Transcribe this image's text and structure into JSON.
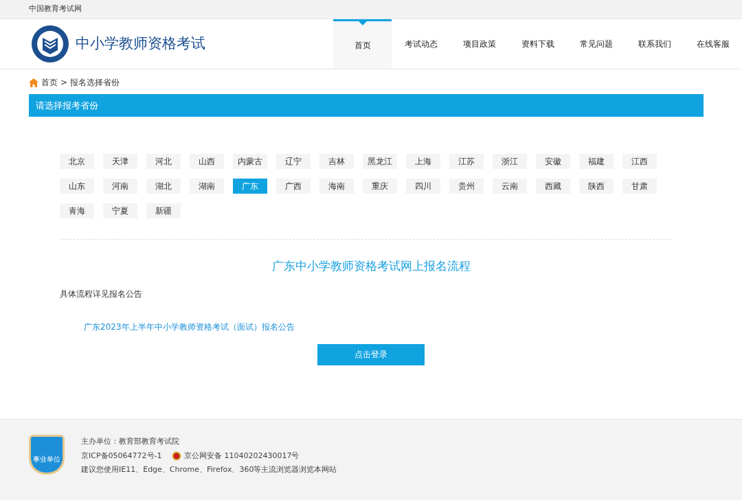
{
  "top_bar": {
    "site_name": "中国教育考试网"
  },
  "header": {
    "title": "中小学教师资格考试"
  },
  "nav": [
    {
      "label": "首页",
      "selected": true
    },
    {
      "label": "考试动态",
      "selected": false
    },
    {
      "label": "项目政策",
      "selected": false
    },
    {
      "label": "资料下载",
      "selected": false
    },
    {
      "label": "常见问题",
      "selected": false
    },
    {
      "label": "联系我们",
      "selected": false
    },
    {
      "label": "在线客服",
      "selected": false
    }
  ],
  "breadcrumb": {
    "home": "首页",
    "separator": ">",
    "current": "报名选择省份"
  },
  "section_title": "请选择报考省份",
  "provinces": [
    {
      "label": "北京",
      "selected": false
    },
    {
      "label": "天津",
      "selected": false
    },
    {
      "label": "河北",
      "selected": false
    },
    {
      "label": "山西",
      "selected": false
    },
    {
      "label": "内蒙古",
      "selected": false
    },
    {
      "label": "辽宁",
      "selected": false
    },
    {
      "label": "吉林",
      "selected": false
    },
    {
      "label": "黑龙江",
      "selected": false
    },
    {
      "label": "上海",
      "selected": false
    },
    {
      "label": "江苏",
      "selected": false
    },
    {
      "label": "浙江",
      "selected": false
    },
    {
      "label": "安徽",
      "selected": false
    },
    {
      "label": "福建",
      "selected": false
    },
    {
      "label": "江西",
      "selected": false
    },
    {
      "label": "山东",
      "selected": false
    },
    {
      "label": "河南",
      "selected": false
    },
    {
      "label": "湖北",
      "selected": false
    },
    {
      "label": "湖南",
      "selected": false
    },
    {
      "label": "广东",
      "selected": true
    },
    {
      "label": "广西",
      "selected": false
    },
    {
      "label": "海南",
      "selected": false
    },
    {
      "label": "重庆",
      "selected": false
    },
    {
      "label": "四川",
      "selected": false
    },
    {
      "label": "贵州",
      "selected": false
    },
    {
      "label": "云南",
      "selected": false
    },
    {
      "label": "西藏",
      "selected": false
    },
    {
      "label": "陕西",
      "selected": false
    },
    {
      "label": "甘肃",
      "selected": false
    },
    {
      "label": "青海",
      "selected": false
    },
    {
      "label": "宁夏",
      "selected": false
    },
    {
      "label": "新疆",
      "selected": false
    }
  ],
  "process": {
    "title": "广东中小学教师资格考试网上报名流程",
    "note": "具体流程详见报名公告",
    "link": "广东2023年上半年中小学教师资格考试（面试）报名公告",
    "button": "点击登录"
  },
  "footer": {
    "badge": "事业单位",
    "sponsor": "主办单位：教育部教育考试院",
    "icp": "京ICP备05064772号-1",
    "police": "京公网安备 11040202430017号",
    "browsers": "建议您使用IE11、Edge、Chrome、Firefox、360等主流浏览器浏览本网站"
  }
}
